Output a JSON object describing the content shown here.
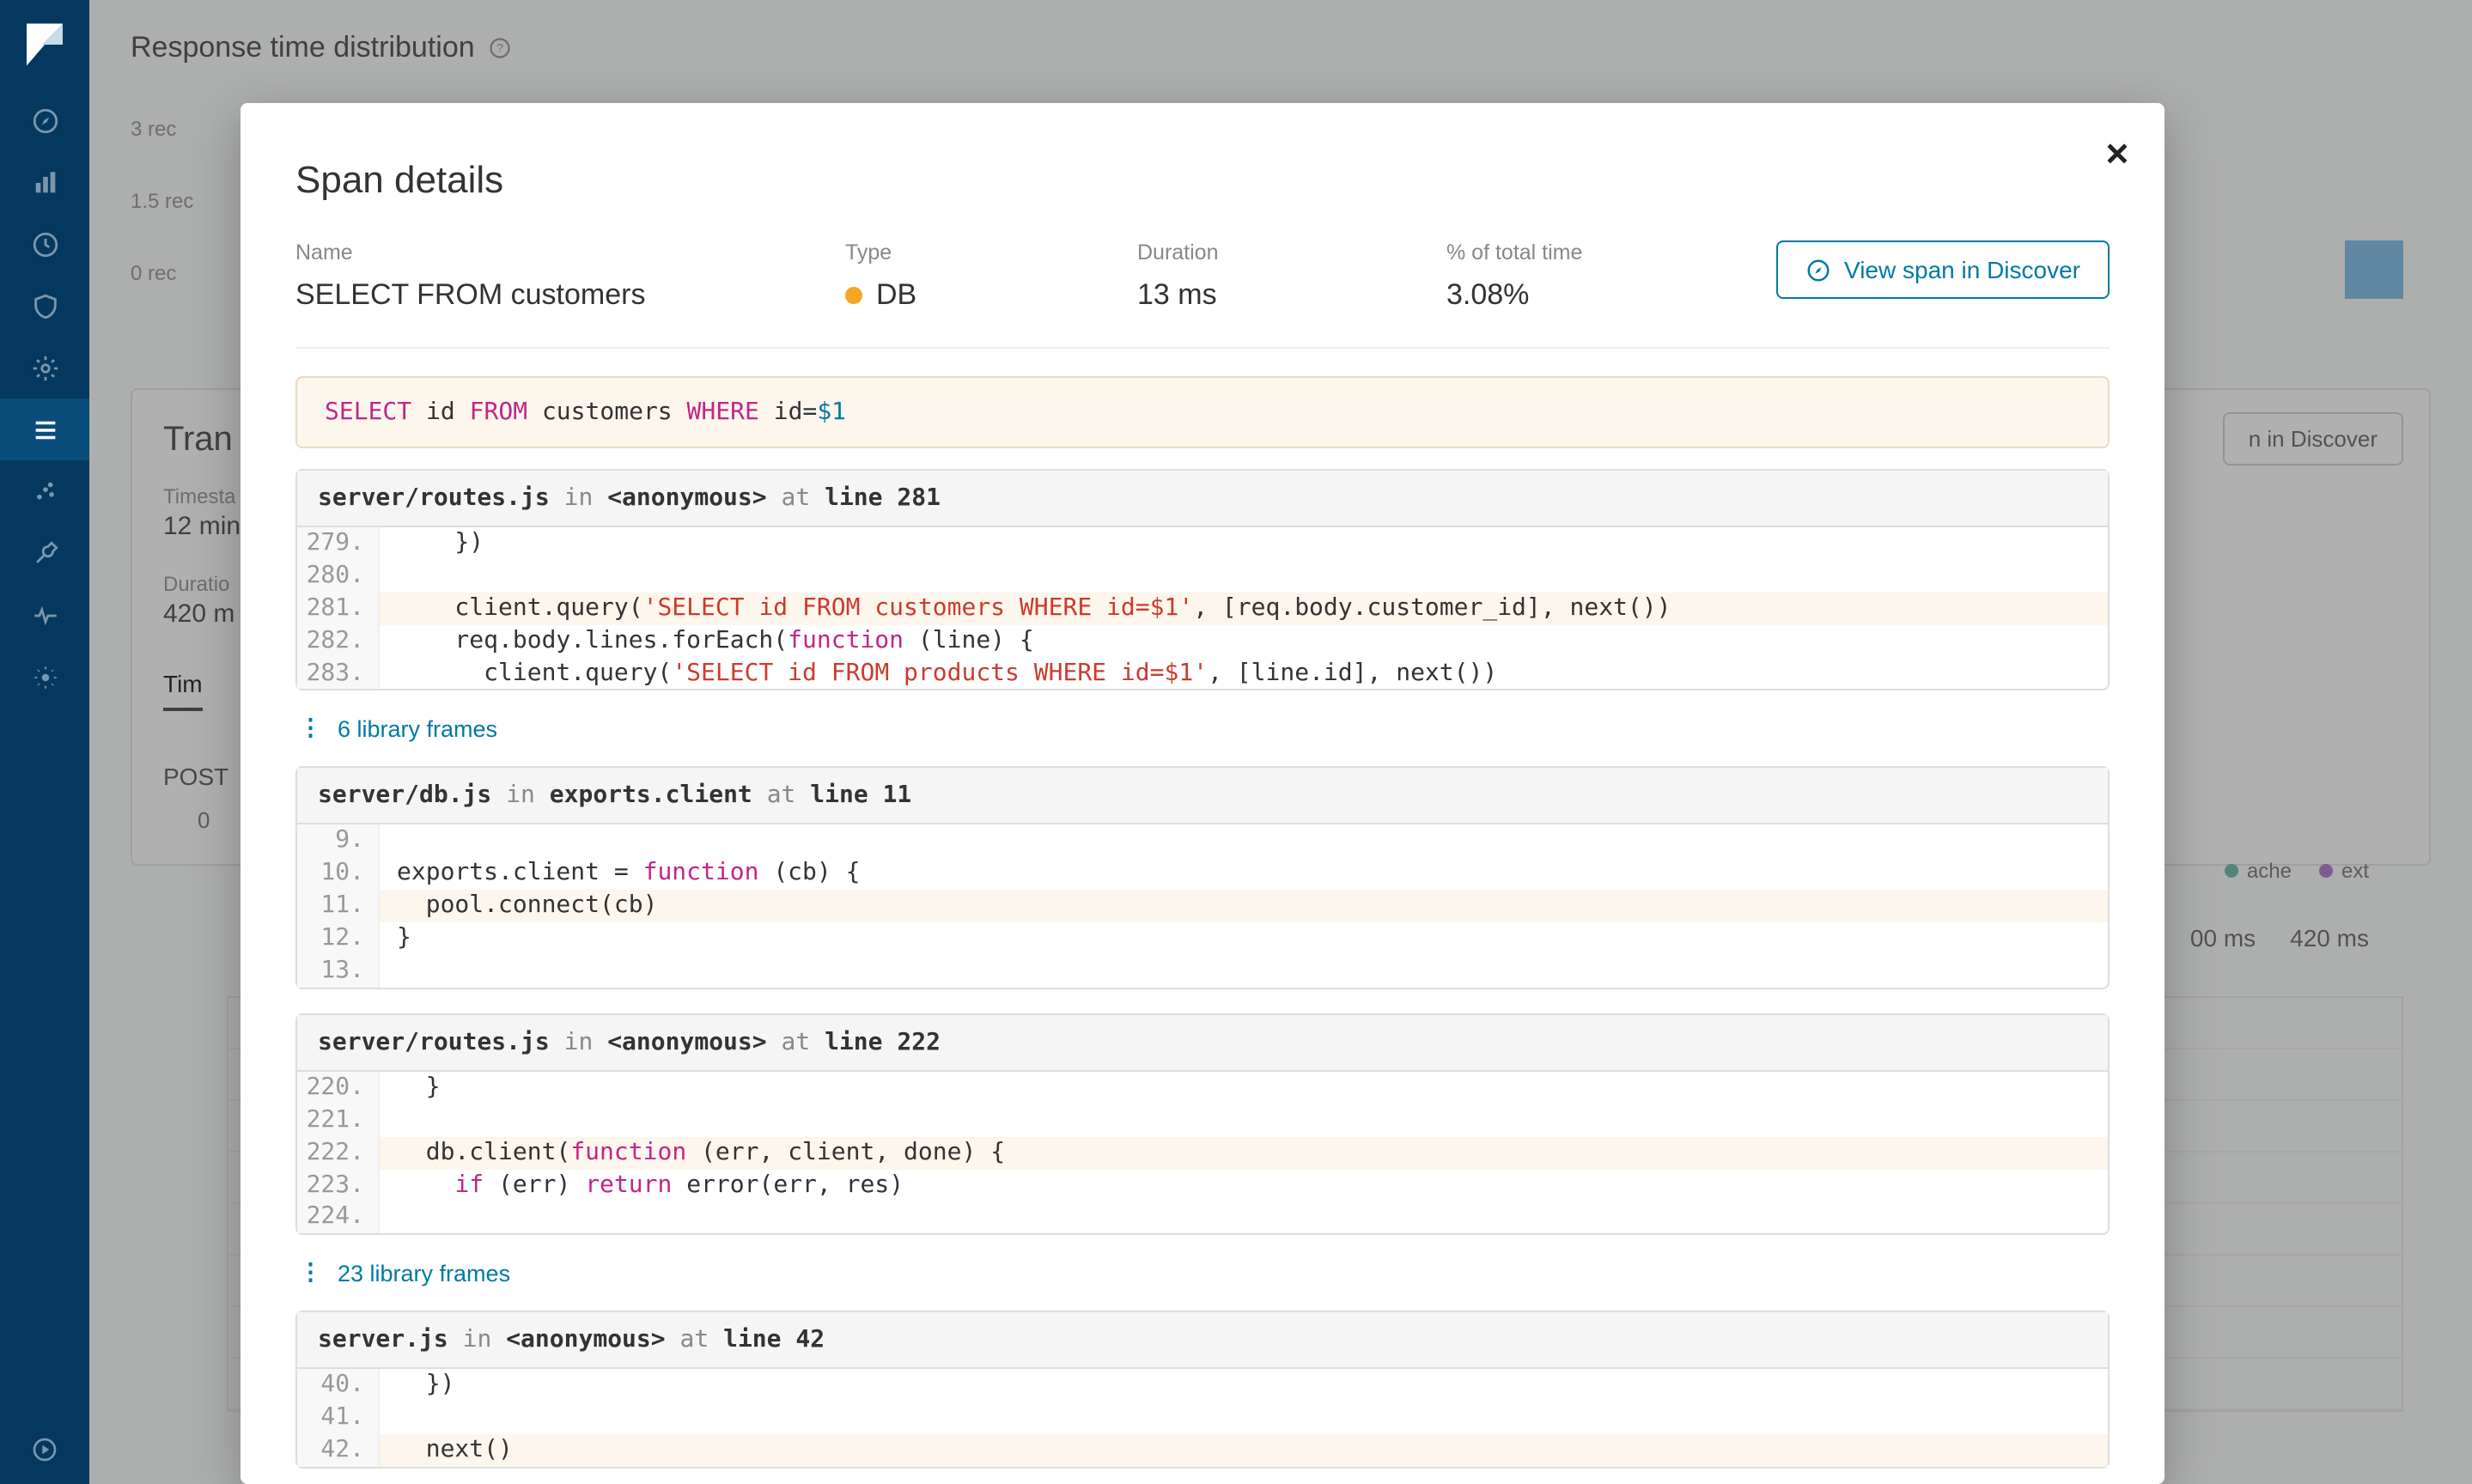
{
  "background": {
    "page_title": "Response time distribution",
    "chart_y_ticks": [
      "3 rec",
      "1.5 rec",
      "0 rec"
    ],
    "card_title": "Tran",
    "timestamp_label": "Timesta",
    "timestamp_value": "12 min",
    "duration_label": "Duratio",
    "duration_value": "420 m",
    "tab_timeline": "Tim",
    "post_label": "POST",
    "discover_button_partial": "n in Discover",
    "legend": [
      {
        "label": "ache",
        "color": "#54b399"
      },
      {
        "label": "ext",
        "color": "#a069c3"
      }
    ],
    "ms_labels": [
      "00 ms",
      "420 ms"
    ]
  },
  "sidebar": {
    "icons": [
      "compass-icon",
      "bar-chart-icon",
      "clock-icon",
      "shield-icon",
      "gear-outline-icon",
      "list-icon",
      "scatter-icon",
      "wrench-icon",
      "heartbeat-icon",
      "settings-icon"
    ],
    "active_index": 5
  },
  "modal": {
    "title": "Span details",
    "labels": {
      "name": "Name",
      "type": "Type",
      "duration": "Duration",
      "pct": "% of total time"
    },
    "values": {
      "name": "SELECT FROM customers",
      "type": "DB",
      "duration": "13 ms",
      "pct": "3.08%"
    },
    "action_button": "View span in Discover",
    "sql": {
      "tokens": [
        {
          "t": "kw",
          "v": "SELECT"
        },
        {
          "t": "sp"
        },
        {
          "t": "txt",
          "v": "id"
        },
        {
          "t": "sp"
        },
        {
          "t": "kw",
          "v": "FROM"
        },
        {
          "t": "sp"
        },
        {
          "t": "txt",
          "v": "customers"
        },
        {
          "t": "sp"
        },
        {
          "t": "kw",
          "v": "WHERE"
        },
        {
          "t": "sp"
        },
        {
          "t": "txt",
          "v": "id="
        },
        {
          "t": "lit",
          "v": "$1"
        }
      ]
    },
    "frames": [
      {
        "file": "server/routes.js",
        "in_text": "in",
        "func": "<anonymous>",
        "at_text": "at",
        "line_kw": "line",
        "line_no": "281",
        "lines": [
          {
            "n": "279",
            "hl": false,
            "seg": [
              {
                "t": "txt",
                "v": "    })"
              }
            ]
          },
          {
            "n": "280",
            "hl": false,
            "seg": [
              {
                "t": "txt",
                "v": ""
              }
            ]
          },
          {
            "n": "281",
            "hl": true,
            "seg": [
              {
                "t": "txt",
                "v": "    client.query("
              },
              {
                "t": "str",
                "v": "'SELECT id FROM customers WHERE id=$1'"
              },
              {
                "t": "txt",
                "v": ", [req.body.customer_id], next())"
              }
            ]
          },
          {
            "n": "282",
            "hl": false,
            "seg": [
              {
                "t": "txt",
                "v": "    req.body.lines.forEach("
              },
              {
                "t": "kw",
                "v": "function"
              },
              {
                "t": "txt",
                "v": " (line) {"
              }
            ]
          },
          {
            "n": "283",
            "hl": false,
            "seg": [
              {
                "t": "txt",
                "v": "      client.query("
              },
              {
                "t": "str",
                "v": "'SELECT id FROM products WHERE id=$1'"
              },
              {
                "t": "txt",
                "v": ", [line.id], next())"
              }
            ]
          }
        ]
      },
      {
        "file": "server/db.js",
        "in_text": "in",
        "func": "exports.client",
        "at_text": "at",
        "line_kw": "line",
        "line_no": "11",
        "lines": [
          {
            "n": "9",
            "hl": false,
            "seg": [
              {
                "t": "txt",
                "v": ""
              }
            ]
          },
          {
            "n": "10",
            "hl": false,
            "seg": [
              {
                "t": "txt",
                "v": "exports.client = "
              },
              {
                "t": "kw",
                "v": "function"
              },
              {
                "t": "txt",
                "v": " (cb) {"
              }
            ]
          },
          {
            "n": "11",
            "hl": true,
            "seg": [
              {
                "t": "txt",
                "v": "  pool.connect(cb)"
              }
            ]
          },
          {
            "n": "12",
            "hl": false,
            "seg": [
              {
                "t": "txt",
                "v": "}"
              }
            ]
          },
          {
            "n": "13",
            "hl": false,
            "seg": [
              {
                "t": "txt",
                "v": ""
              }
            ]
          }
        ]
      },
      {
        "file": "server/routes.js",
        "in_text": "in",
        "func": "<anonymous>",
        "at_text": "at",
        "line_kw": "line",
        "line_no": "222",
        "lines": [
          {
            "n": "220",
            "hl": false,
            "seg": [
              {
                "t": "txt",
                "v": "  }"
              }
            ]
          },
          {
            "n": "221",
            "hl": false,
            "seg": [
              {
                "t": "txt",
                "v": ""
              }
            ]
          },
          {
            "n": "222",
            "hl": true,
            "seg": [
              {
                "t": "txt",
                "v": "  db.client("
              },
              {
                "t": "kw",
                "v": "function"
              },
              {
                "t": "txt",
                "v": " (err, client, done) {"
              }
            ]
          },
          {
            "n": "223",
            "hl": false,
            "seg": [
              {
                "t": "txt",
                "v": "    "
              },
              {
                "t": "kw",
                "v": "if"
              },
              {
                "t": "txt",
                "v": " (err) "
              },
              {
                "t": "kw",
                "v": "return"
              },
              {
                "t": "txt",
                "v": " error(err, res)"
              }
            ]
          },
          {
            "n": "224",
            "hl": false,
            "seg": [
              {
                "t": "txt",
                "v": ""
              }
            ]
          }
        ]
      },
      {
        "file": "server.js",
        "in_text": "in",
        "func": "<anonymous>",
        "at_text": "at",
        "line_kw": "line",
        "line_no": "42",
        "lines": [
          {
            "n": "40",
            "hl": false,
            "seg": [
              {
                "t": "txt",
                "v": "  })"
              }
            ]
          },
          {
            "n": "41",
            "hl": false,
            "seg": [
              {
                "t": "txt",
                "v": ""
              }
            ]
          },
          {
            "n": "42",
            "hl": true,
            "seg": [
              {
                "t": "txt",
                "v": "  next()"
              }
            ]
          }
        ]
      }
    ],
    "library_links": [
      {
        "count": "6",
        "label": "library frames",
        "after_frame_index": 0
      },
      {
        "count": "23",
        "label": "library frames",
        "after_frame_index": 2
      }
    ]
  }
}
